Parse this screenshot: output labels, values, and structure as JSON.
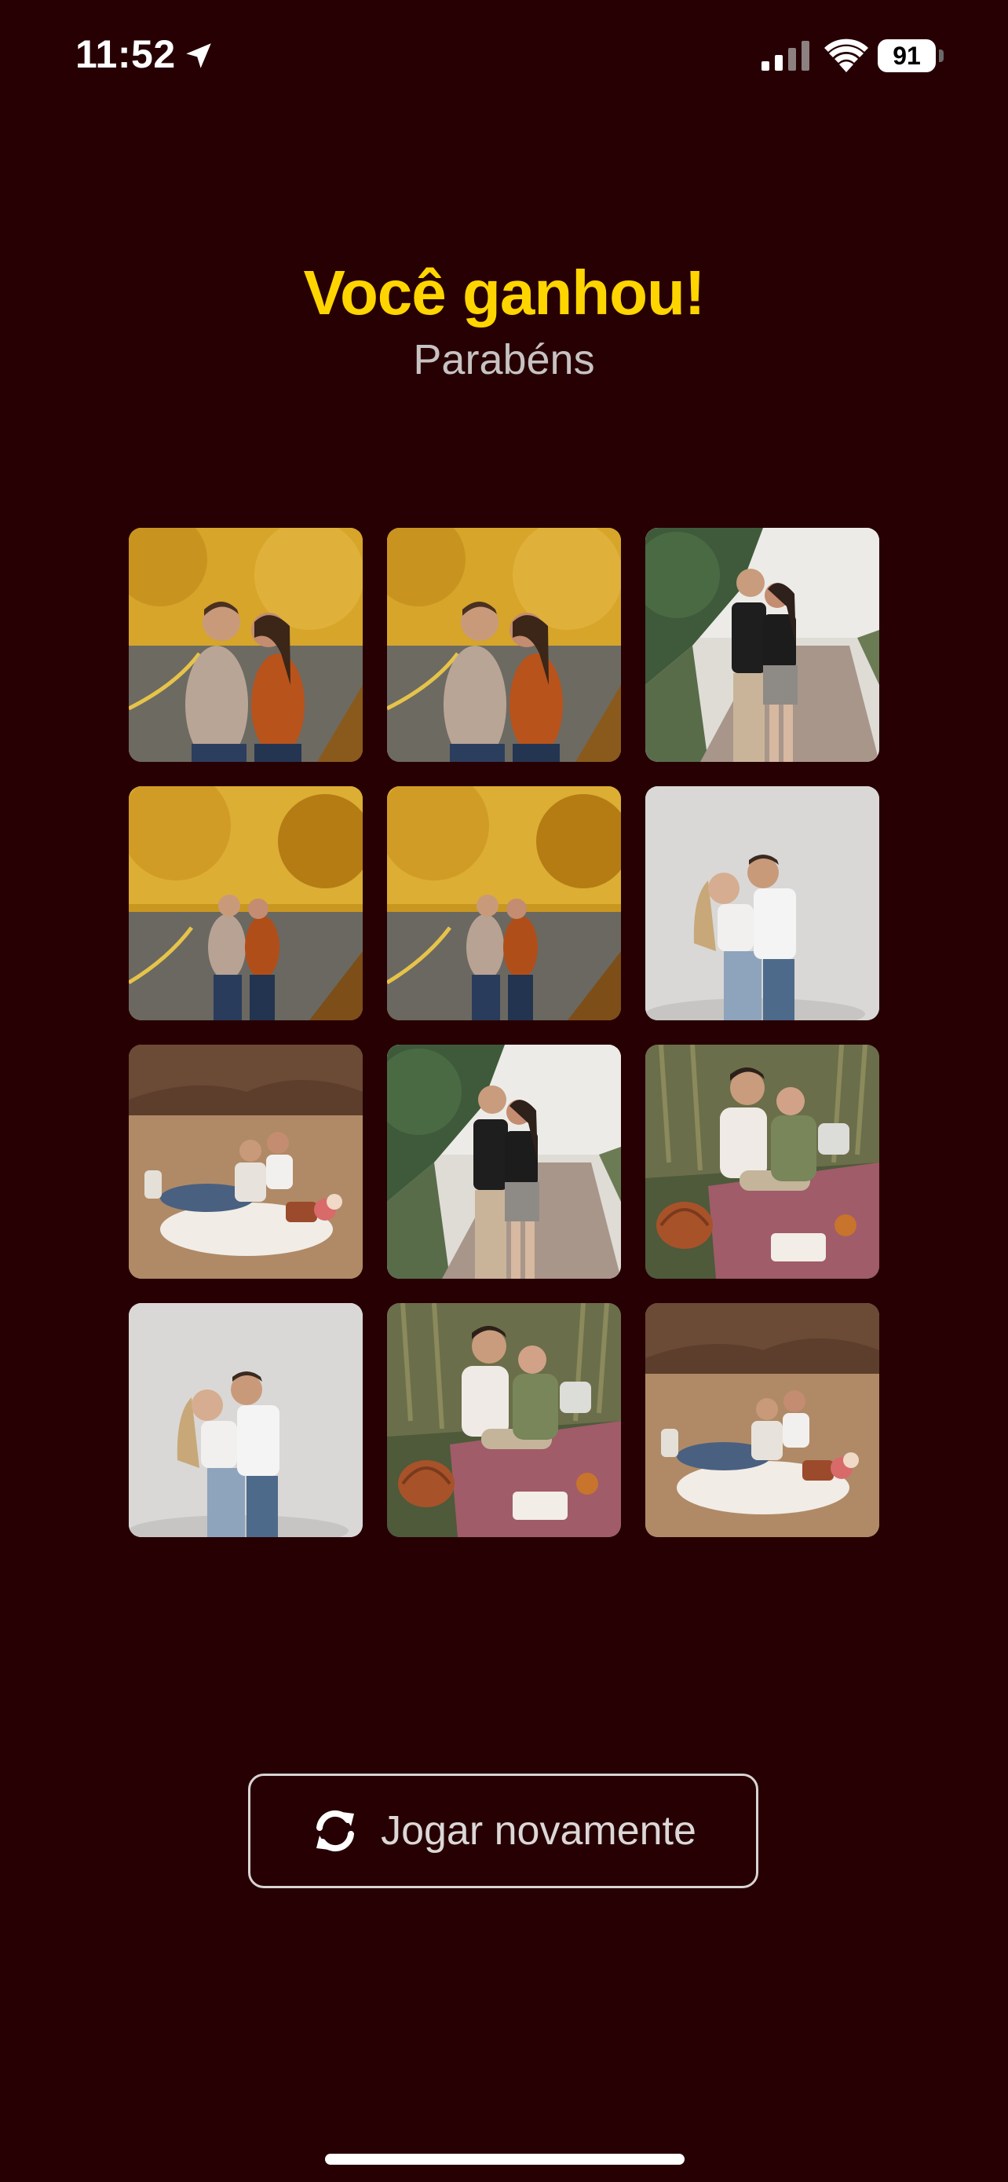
{
  "status_bar": {
    "time": "11:52",
    "battery": "91",
    "icons": [
      "location-arrow-icon",
      "cellular-signal-icon",
      "wifi-icon",
      "battery-icon"
    ]
  },
  "result": {
    "title": "Você ganhou!",
    "subtitle": "Parabéns"
  },
  "grid": {
    "columns": 3,
    "cards": [
      {
        "photo": "couple-autumn-road-close"
      },
      {
        "photo": "couple-autumn-road-close"
      },
      {
        "photo": "couple-coastal-path"
      },
      {
        "photo": "couple-autumn-road-wide"
      },
      {
        "photo": "couple-autumn-road-wide"
      },
      {
        "photo": "couple-studio-embrace"
      },
      {
        "photo": "couple-field-picnic"
      },
      {
        "photo": "couple-coastal-path"
      },
      {
        "photo": "couple-grass-picnic"
      },
      {
        "photo": "couple-studio-embrace"
      },
      {
        "photo": "couple-grass-picnic"
      },
      {
        "photo": "couple-field-picnic"
      }
    ]
  },
  "actions": {
    "play_again_label": "Jogar novamente",
    "play_again_icon": "refresh-icon"
  },
  "colors": {
    "background": "#270003",
    "title": "#ffd500",
    "subtitle": "#c7c2c2",
    "button_border": "#d9d4d4"
  }
}
